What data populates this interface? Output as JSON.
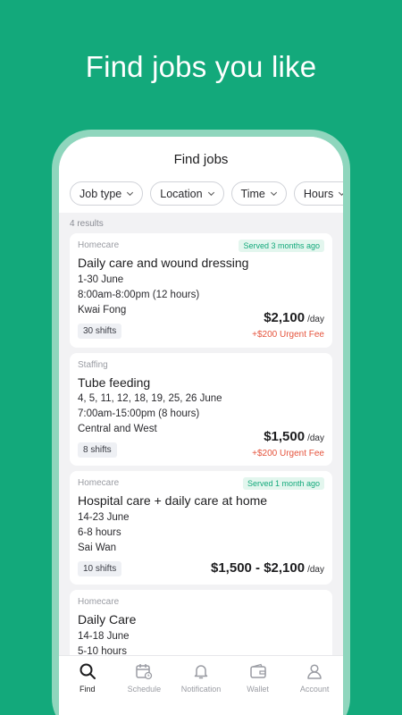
{
  "headline": "Find jobs you like",
  "page_title": "Find jobs",
  "filters": [
    "Job type",
    "Location",
    "Time",
    "Hours"
  ],
  "results_count": "4 results",
  "jobs": [
    {
      "category": "Homecare",
      "badge": "Served 3 months ago",
      "title": "Daily care and wound dressing",
      "dates": "1-30 June",
      "time": "8:00am-8:00pm (12 hours)",
      "location": "Kwai Fong",
      "shifts": "30 shifts",
      "price": "$2,100",
      "unit": "/day",
      "urgent_fee": "+$200 Urgent Fee"
    },
    {
      "category": "Staffing",
      "title": "Tube feeding",
      "dates": "4, 5, 11, 12, 18, 19, 25, 26 June",
      "time": "7:00am-15:00pm (8 hours)",
      "location": "Central and West",
      "shifts": "8 shifts",
      "price": "$1,500",
      "unit": "/day",
      "urgent_fee": "+$200 Urgent Fee"
    },
    {
      "category": "Homecare",
      "badge": "Served 1 month ago",
      "title": "Hospital care + daily care at home",
      "dates": "14-23 June",
      "time": "6-8 hours",
      "location": "Sai Wan",
      "shifts": "10 shifts",
      "price": "$1,500 - $2,100",
      "unit": "/day"
    },
    {
      "category": "Homecare",
      "title": "Daily Care",
      "dates": "14-18 June",
      "time": "5-10 hours"
    }
  ],
  "tabs": [
    {
      "label": "Find",
      "icon": "search-icon",
      "active": true
    },
    {
      "label": "Schedule",
      "icon": "calendar-icon"
    },
    {
      "label": "Notification",
      "icon": "bell-icon"
    },
    {
      "label": "Wallet",
      "icon": "wallet-icon"
    },
    {
      "label": "Account",
      "icon": "user-icon"
    }
  ],
  "colors": {
    "brand": "#13a97b",
    "urgent": "#e5533c"
  }
}
